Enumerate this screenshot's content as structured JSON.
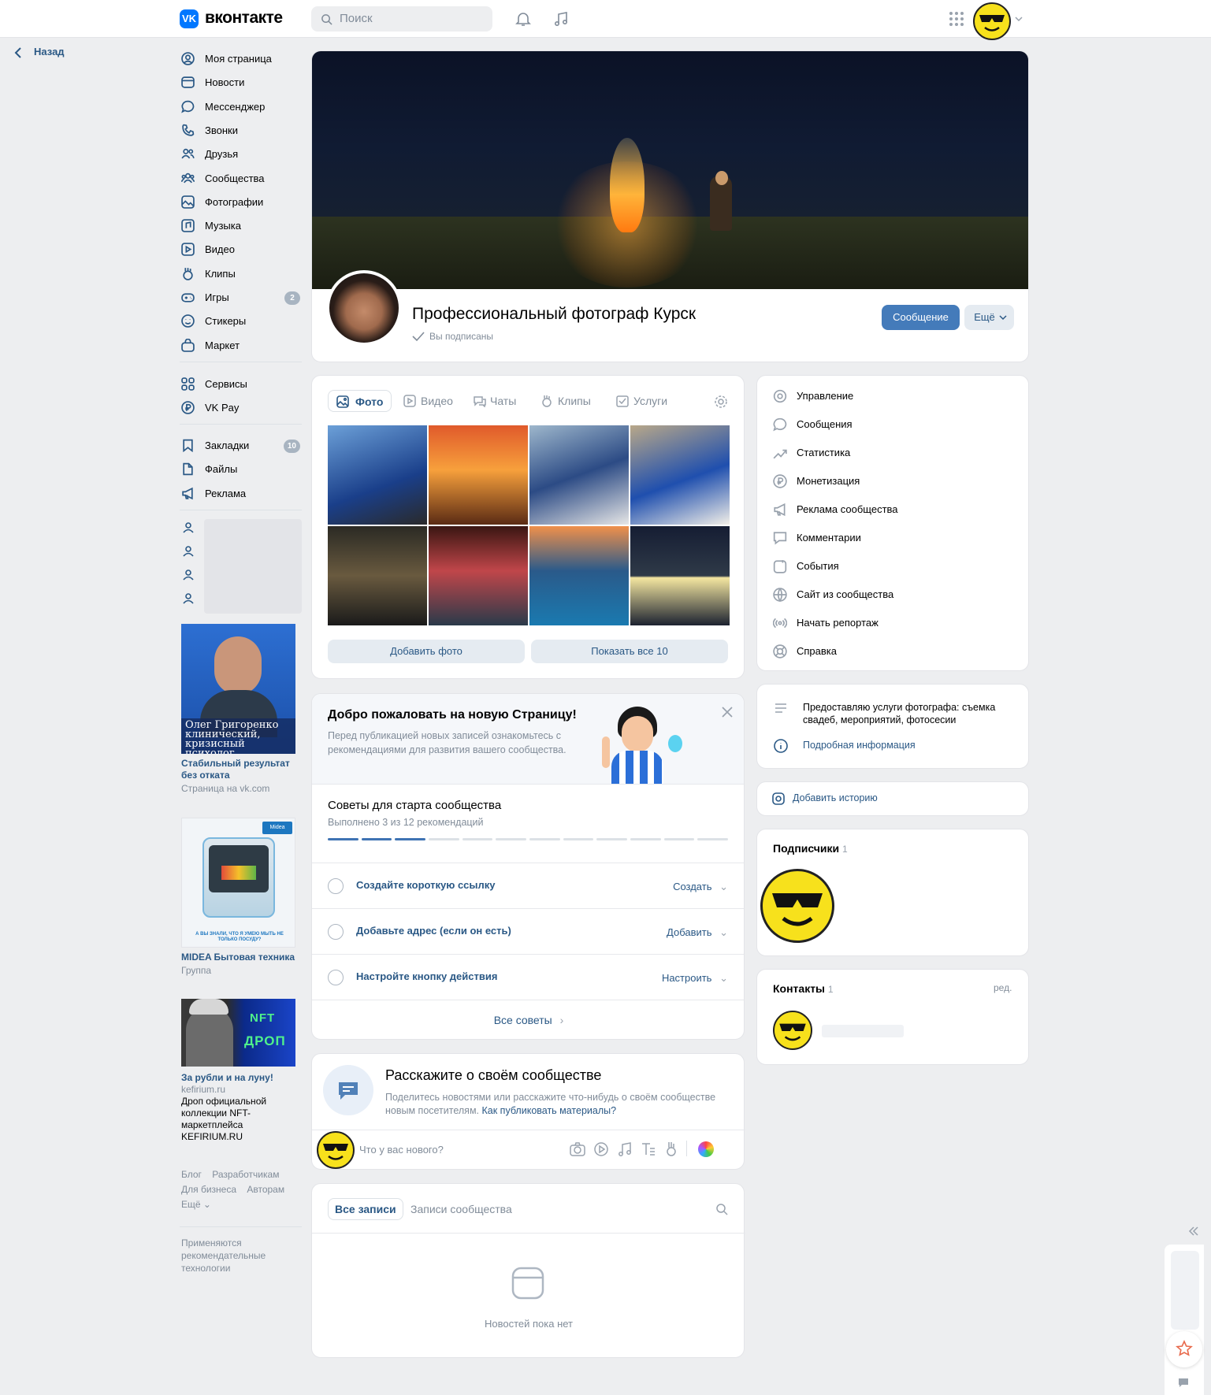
{
  "header": {
    "logo_text": "вконтакте",
    "logo_mark": "VK",
    "search_placeholder": "Поиск"
  },
  "sidebar": {
    "back_label": "Назад",
    "items": [
      {
        "label": "Моя страница",
        "icon": "user-circle-icon"
      },
      {
        "label": "Новости",
        "icon": "newsfeed-icon"
      },
      {
        "label": "Мессенджер",
        "icon": "message-icon"
      },
      {
        "label": "Звонки",
        "icon": "phone-icon"
      },
      {
        "label": "Друзья",
        "icon": "friends-icon"
      },
      {
        "label": "Сообщества",
        "icon": "communities-icon"
      },
      {
        "label": "Фотографии",
        "icon": "photos-icon"
      },
      {
        "label": "Музыка",
        "icon": "music-icon"
      },
      {
        "label": "Видео",
        "icon": "video-icon"
      },
      {
        "label": "Клипы",
        "icon": "clips-icon"
      },
      {
        "label": "Игры",
        "icon": "games-icon",
        "badge": "2"
      },
      {
        "label": "Стикеры",
        "icon": "stickers-icon"
      },
      {
        "label": "Маркет",
        "icon": "market-icon"
      }
    ],
    "items2": [
      {
        "label": "Сервисы",
        "icon": "services-icon"
      },
      {
        "label": "VK Pay",
        "icon": "vkpay-icon"
      }
    ],
    "items3": [
      {
        "label": "Закладки",
        "icon": "bookmark-icon",
        "badge": "10"
      },
      {
        "label": "Файлы",
        "icon": "file-icon"
      },
      {
        "label": "Реклама",
        "icon": "ads-icon"
      }
    ],
    "ads": [
      {
        "banner": "Олег Григоренко\nклинический,\nкризисный психолог",
        "title": "Стабильный результат без отката",
        "sub": "Страница на vk.com"
      },
      {
        "banner": "А ВЫ ЗНАЛИ, ЧТО Я УМЕЮ МЫТЬ НЕ ТОЛЬКО ПОСУДУ?",
        "brand": "Midea",
        "title": "MIDEA Бытовая техника",
        "sub": "Группа"
      },
      {
        "banner1": "NFT",
        "banner2": "ДРОП",
        "title": "За рубли и на луну!",
        "site": "kefirium.ru",
        "desc": "Дроп официальной коллекции NFT-маркетплейса KEFIRIUM.RU"
      }
    ],
    "footer_links": [
      "Блог",
      "Разработчикам",
      "Для бизнеса",
      "Авторам",
      "Ещё"
    ],
    "footer_note": "Применяются рекомендательные технологии"
  },
  "profile": {
    "name": "Профессиональный фотограф Курск",
    "status": "Вы подписаны",
    "message_button": "Сообщение",
    "more_button": "Ещё"
  },
  "media": {
    "tabs": [
      "Фото",
      "Видео",
      "Чаты",
      "Клипы",
      "Услуги"
    ],
    "add_photo": "Добавить фото",
    "show_all": "Показать все 10"
  },
  "welcome": {
    "title": "Добро пожаловать на новую Страницу!",
    "text": "Перед публикацией новых записей ознакомьтесь с рекомендациями для развития вашего сообщества.",
    "tips_title": "Советы для старта сообщества",
    "tips_progress": "Выполнено 3 из 12 рекомендаций",
    "progress_done": 3,
    "progress_total": 12,
    "tips": [
      {
        "label": "Создайте короткую ссылку",
        "action": "Создать"
      },
      {
        "label": "Добавьте адрес (если он есть)",
        "action": "Добавить"
      },
      {
        "label": "Настройте кнопку действия",
        "action": "Настроить"
      }
    ],
    "all_tips": "Все советы"
  },
  "about": {
    "title": "Расскажите о своём сообществе",
    "text": "Поделитесь новостями или расскажите что-нибудь о своём сообществе новым посетителям.",
    "link": "Как публиковать материалы?",
    "composer_placeholder": "Что у вас нового?"
  },
  "wall": {
    "tab_all": "Все записи",
    "tab_community": "Записи сообщества",
    "empty": "Новостей пока нет"
  },
  "right_menu": [
    {
      "label": "Управление",
      "icon": "settings-icon"
    },
    {
      "label": "Сообщения",
      "icon": "message-icon"
    },
    {
      "label": "Статистика",
      "icon": "stats-icon"
    },
    {
      "label": "Монетизация",
      "icon": "ruble-icon"
    },
    {
      "label": "Реклама сообщества",
      "icon": "megaphone-icon"
    },
    {
      "label": "Комментарии",
      "icon": "comment-icon"
    },
    {
      "label": "События",
      "icon": "calendar-icon"
    },
    {
      "label": "Сайт из сообщества",
      "icon": "globe-icon"
    },
    {
      "label": "Начать репортаж",
      "icon": "live-icon"
    },
    {
      "label": "Справка",
      "icon": "help-icon"
    }
  ],
  "info": {
    "description": "Предоставляю услуги фотографа: съемка свадеб, мероприятий, фотосесии",
    "more": "Подробная информация",
    "add_story": "Добавить историю"
  },
  "subscribers": {
    "title": "Подписчики",
    "count": "1"
  },
  "contacts": {
    "title": "Контакты",
    "count": "1",
    "edit": "ред."
  }
}
